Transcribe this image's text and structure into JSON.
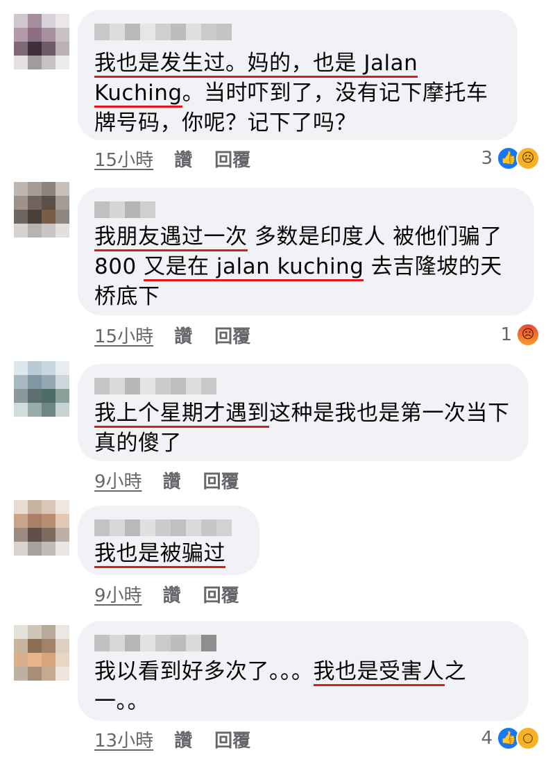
{
  "comments": [
    {
      "text_parts": [
        {
          "t": "我也是发生过。妈的，也是 Jalan Kuching",
          "u": true
        },
        {
          "t": "。当时吓到了，没有记下摩托车牌号码，你呢？记下了吗？",
          "u": false
        }
      ],
      "time": "15小時",
      "like_label": "讚",
      "reply_label": "回覆",
      "reaction_count": "3",
      "reactions": [
        "like-icon",
        "sad-icon"
      ]
    },
    {
      "text_parts": [
        {
          "t": "我朋友遇过一次",
          "u": true
        },
        {
          "t": " 多数是印度人 被他们骗了800 ",
          "u": false
        },
        {
          "t": "又是在 jalan kuching",
          "u": true
        },
        {
          "t": " 去吉隆坡的天桥底下",
          "u": false
        }
      ],
      "time": "15小時",
      "like_label": "讚",
      "reply_label": "回覆",
      "reaction_count": "1",
      "reactions": [
        "angry-icon"
      ]
    },
    {
      "text_parts": [
        {
          "t": "我上个星期才遇到",
          "u": true
        },
        {
          "t": "这种是我也是第一次当下真的傻了",
          "u": false
        }
      ],
      "time": "9小時",
      "like_label": "讚",
      "reply_label": "回覆",
      "reaction_count": "",
      "reactions": []
    },
    {
      "text_parts": [
        {
          "t": "我也是被骗过",
          "u": true
        }
      ],
      "time": "9小時",
      "like_label": "讚",
      "reply_label": "回覆",
      "reaction_count": "",
      "reactions": []
    },
    {
      "text_parts": [
        {
          "t": "我以看到好多次了。。。",
          "u": false
        },
        {
          "t": "我也是受害人",
          "u": true
        },
        {
          "t": "之一。。",
          "u": false
        }
      ],
      "time": "13小時",
      "like_label": "讚",
      "reply_label": "回覆",
      "reaction_count": "4",
      "reactions": [
        "like-icon",
        "wow-icon"
      ]
    }
  ],
  "colors": {
    "bubble": "#f0f2f5",
    "underline": "#e0191f",
    "meta_text": "#65676b",
    "like": "#1877f2"
  }
}
